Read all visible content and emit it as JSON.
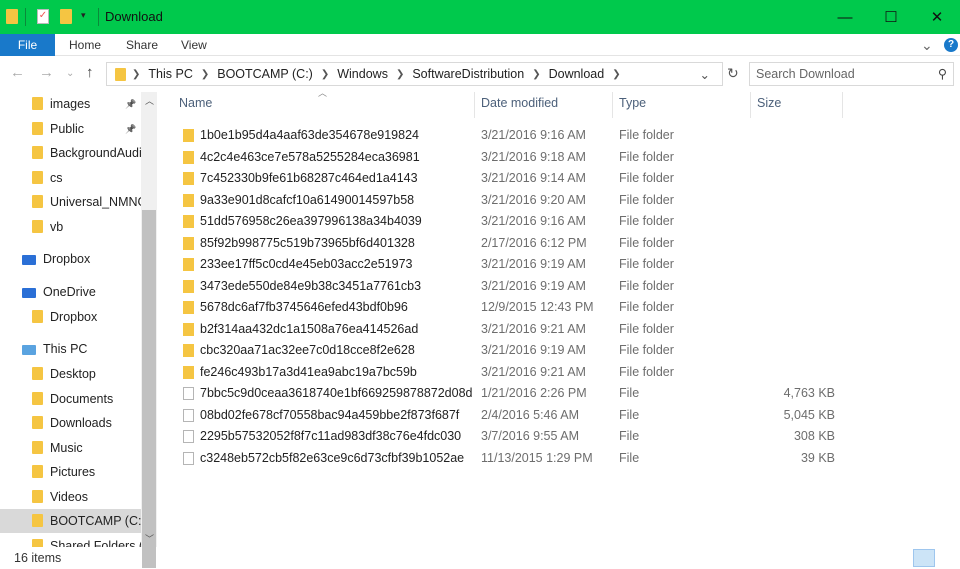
{
  "window": {
    "title": "Download",
    "minimize": "—",
    "maximize": "☐",
    "close": "✕"
  },
  "ribbon": {
    "tabs": [
      "File",
      "Home",
      "Share",
      "View"
    ],
    "expand": "⌄",
    "help": "?"
  },
  "address": {
    "path": [
      "This PC",
      "BOOTCAMP (C:)",
      "Windows",
      "SoftwareDistribution",
      "Download"
    ],
    "search_placeholder": "Search Download",
    "refresh": "↻"
  },
  "nav": [
    {
      "label": "images",
      "pinned": true
    },
    {
      "label": "Public",
      "pinned": true
    },
    {
      "label": "BackgroundAudi"
    },
    {
      "label": "cs"
    },
    {
      "label": "Universal_NMNG"
    },
    {
      "label": "vb"
    },
    {
      "label": "Dropbox",
      "root": true
    },
    {
      "label": "OneDrive",
      "root": true
    },
    {
      "label": "Dropbox"
    },
    {
      "label": "This PC",
      "root": true
    },
    {
      "label": "Desktop"
    },
    {
      "label": "Documents"
    },
    {
      "label": "Downloads"
    },
    {
      "label": "Music"
    },
    {
      "label": "Pictures"
    },
    {
      "label": "Videos"
    },
    {
      "label": "BOOTCAMP (C:)",
      "selected": true
    },
    {
      "label": "Shared Folders ("
    }
  ],
  "columns": [
    "Name",
    "Date modified",
    "Type",
    "Size"
  ],
  "files": [
    {
      "name": "1b0e1b95d4a4aaf63de354678e919824",
      "date": "3/21/2016 9:16 AM",
      "type": "File folder",
      "size": "",
      "kind": "folder"
    },
    {
      "name": "4c2c4e463ce7e578a5255284eca36981",
      "date": "3/21/2016 9:18 AM",
      "type": "File folder",
      "size": "",
      "kind": "folder"
    },
    {
      "name": "7c452330b9fe61b68287c464ed1a4143",
      "date": "3/21/2016 9:14 AM",
      "type": "File folder",
      "size": "",
      "kind": "folder"
    },
    {
      "name": "9a33e901d8cafcf10a61490014597b58",
      "date": "3/21/2016 9:20 AM",
      "type": "File folder",
      "size": "",
      "kind": "folder"
    },
    {
      "name": "51dd576958c26ea397996138a34b4039",
      "date": "3/21/2016 9:16 AM",
      "type": "File folder",
      "size": "",
      "kind": "folder"
    },
    {
      "name": "85f92b998775c519b73965bf6d401328",
      "date": "2/17/2016 6:12 PM",
      "type": "File folder",
      "size": "",
      "kind": "folder"
    },
    {
      "name": "233ee17ff5c0cd4e45eb03acc2e51973",
      "date": "3/21/2016 9:19 AM",
      "type": "File folder",
      "size": "",
      "kind": "folder"
    },
    {
      "name": "3473ede550de84e9b38c3451a7761cb3",
      "date": "3/21/2016 9:19 AM",
      "type": "File folder",
      "size": "",
      "kind": "folder"
    },
    {
      "name": "5678dc6af7fb3745646efed43bdf0b96",
      "date": "12/9/2015 12:43 PM",
      "type": "File folder",
      "size": "",
      "kind": "folder"
    },
    {
      "name": "b2f314aa432dc1a1508a76ea414526ad",
      "date": "3/21/2016 9:21 AM",
      "type": "File folder",
      "size": "",
      "kind": "folder"
    },
    {
      "name": "cbc320aa71ac32ee7c0d18cce8f2e628",
      "date": "3/21/2016 9:19 AM",
      "type": "File folder",
      "size": "",
      "kind": "folder"
    },
    {
      "name": "fe246c493b17a3d41ea9abc19a7bc59b",
      "date": "3/21/2016 9:21 AM",
      "type": "File folder",
      "size": "",
      "kind": "folder"
    },
    {
      "name": "7bbc5c9d0ceaa3618740e1bf669259878872d08d",
      "date": "1/21/2016 2:26 PM",
      "type": "File",
      "size": "4,763 KB",
      "kind": "file"
    },
    {
      "name": "08bd02fe678cf70558bac94a459bbe2f873f687f",
      "date": "2/4/2016 5:46 AM",
      "type": "File",
      "size": "5,045 KB",
      "kind": "file"
    },
    {
      "name": "2295b57532052f8f7c11ad983df38c76e4fdc030",
      "date": "3/7/2016 9:55 AM",
      "type": "File",
      "size": "308 KB",
      "kind": "file"
    },
    {
      "name": "c3248eb572cb5f82e63ce9c6d73cfbf39b1052ae",
      "date": "11/13/2015 1:29 PM",
      "type": "File",
      "size": "39 KB",
      "kind": "file"
    }
  ],
  "status": {
    "count": "16 items"
  },
  "colors": {
    "titlebar": "#00c94c",
    "file_tab": "#1979ca",
    "folder": "#f5c542"
  }
}
